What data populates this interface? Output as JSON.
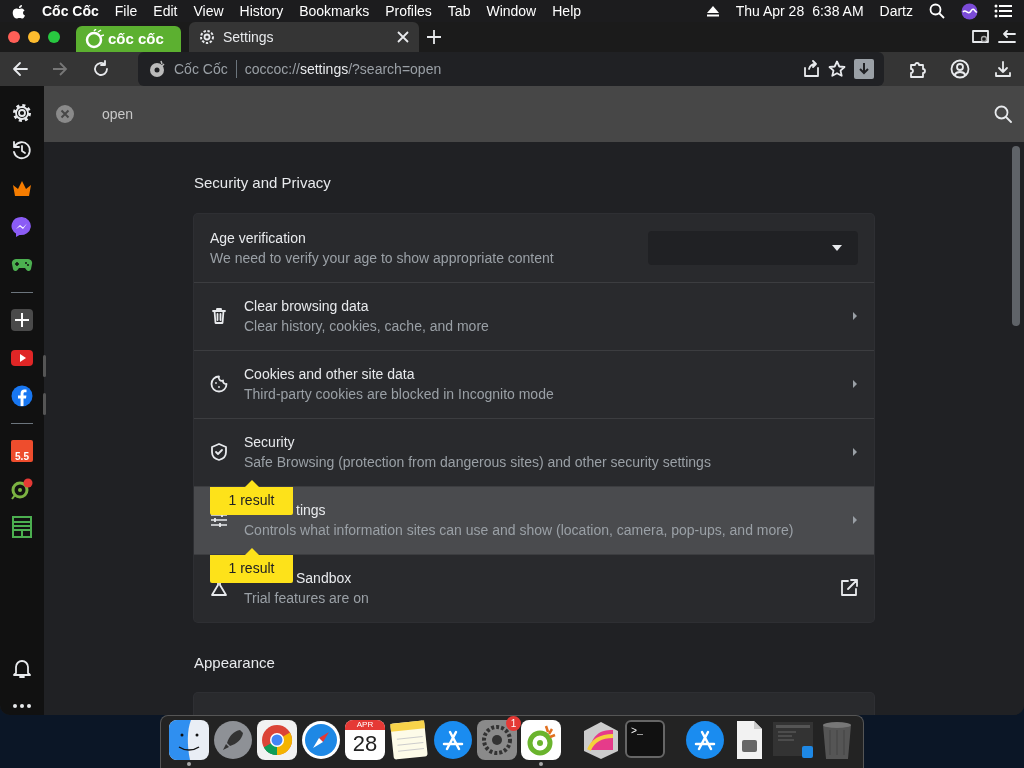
{
  "menu_bar": {
    "app_name": "Cốc Cốc",
    "menus": [
      "File",
      "Edit",
      "View",
      "History",
      "Bookmarks",
      "Profiles",
      "Tab",
      "Window",
      "Help"
    ],
    "date": "Thu Apr 28",
    "time": "6:38 AM",
    "user": "Dartz"
  },
  "tabs": [
    {
      "kind": "logo",
      "label": "cốc cốc",
      "selected": false
    },
    {
      "kind": "page",
      "label": "Settings",
      "selected": true
    }
  ],
  "address_bar": {
    "site_label": "Cốc Cốc",
    "url": "coccoc://**settings**/?search=open"
  },
  "sidebar": {
    "items": [
      {
        "kind": "settings",
        "open": false
      },
      {
        "kind": "history",
        "open": false
      },
      {
        "kind": "crown",
        "open": false
      },
      {
        "kind": "messenger",
        "open": false
      },
      {
        "kind": "game",
        "open": false
      },
      {
        "kind": "divider"
      },
      {
        "kind": "add",
        "open": false
      },
      {
        "kind": "youtube",
        "open": true
      },
      {
        "kind": "facebook",
        "open": true
      },
      {
        "kind": "divider"
      },
      {
        "kind": "shop",
        "label": "5.5",
        "open": false
      },
      {
        "kind": "pin",
        "open": false
      },
      {
        "kind": "sheet",
        "open": false
      },
      {
        "kind": "spacer"
      },
      {
        "kind": "bell",
        "open": false
      },
      {
        "kind": "more",
        "open": false
      }
    ]
  },
  "search": {
    "value": "open"
  },
  "sections": [
    {
      "title": "Security and Privacy",
      "rows": [
        {
          "kind": "select",
          "title": "Age verification",
          "description": "We need to verify your age to show appropriate content",
          "hovered": false
        },
        {
          "kind": "link",
          "title": "Clear browsing data",
          "description": "Clear history, cookies, cache, and more",
          "hovered": false
        },
        {
          "kind": "link",
          "title": "Cookies and other site data",
          "description": "Third-party cookies are blocked in Incognito mode",
          "hovered": false
        },
        {
          "kind": "link",
          "title": "Security",
          "description": "Safe Browsing (protection from dangerous sites) and other security settings",
          "hovered": false
        },
        {
          "kind": "link",
          "title": "tings",
          "description": "Controls what information sites can use and show (location, camera, pop-ups, and more)",
          "hovered": true,
          "bubble": "1 result"
        },
        {
          "kind": "external",
          "title": "Sandbox",
          "description": "Trial features are on",
          "hovered": false,
          "bubble": "1 result"
        }
      ]
    },
    {
      "title": "Appearance"
    }
  ],
  "dock": [
    {
      "kind": "finder",
      "running": true
    },
    {
      "kind": "rocket",
      "running": false
    },
    {
      "kind": "chrome",
      "running": false
    },
    {
      "kind": "compass",
      "running": false
    },
    {
      "kind": "calendar",
      "month": "APR",
      "day": "28",
      "running": false
    },
    {
      "kind": "notes",
      "running": false
    },
    {
      "kind": "store",
      "running": false
    },
    {
      "kind": "gear",
      "badge": "1",
      "running": false
    },
    {
      "kind": "coccoc",
      "running": true
    },
    {
      "kind": "separator"
    },
    {
      "kind": "grapher",
      "running": false
    },
    {
      "kind": "terminal",
      "prompt": ">_",
      "running": false
    },
    {
      "kind": "separator"
    },
    {
      "kind": "store",
      "running": false
    },
    {
      "kind": "document",
      "running": false
    },
    {
      "kind": "window",
      "running": false
    },
    {
      "kind": "trash",
      "running": false
    }
  ]
}
